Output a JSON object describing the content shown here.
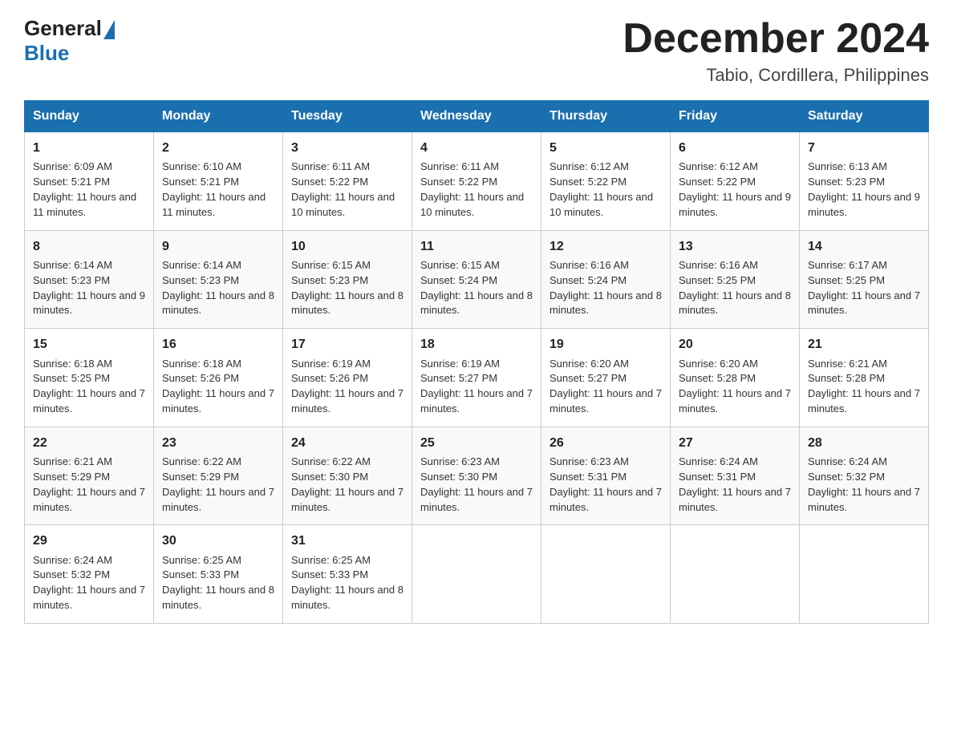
{
  "header": {
    "logo_general": "General",
    "logo_blue": "Blue",
    "month_title": "December 2024",
    "subtitle": "Tabio, Cordillera, Philippines"
  },
  "weekdays": [
    "Sunday",
    "Monday",
    "Tuesday",
    "Wednesday",
    "Thursday",
    "Friday",
    "Saturday"
  ],
  "weeks": [
    [
      {
        "day": "1",
        "sunrise": "Sunrise: 6:09 AM",
        "sunset": "Sunset: 5:21 PM",
        "daylight": "Daylight: 11 hours and 11 minutes."
      },
      {
        "day": "2",
        "sunrise": "Sunrise: 6:10 AM",
        "sunset": "Sunset: 5:21 PM",
        "daylight": "Daylight: 11 hours and 11 minutes."
      },
      {
        "day": "3",
        "sunrise": "Sunrise: 6:11 AM",
        "sunset": "Sunset: 5:22 PM",
        "daylight": "Daylight: 11 hours and 10 minutes."
      },
      {
        "day": "4",
        "sunrise": "Sunrise: 6:11 AM",
        "sunset": "Sunset: 5:22 PM",
        "daylight": "Daylight: 11 hours and 10 minutes."
      },
      {
        "day": "5",
        "sunrise": "Sunrise: 6:12 AM",
        "sunset": "Sunset: 5:22 PM",
        "daylight": "Daylight: 11 hours and 10 minutes."
      },
      {
        "day": "6",
        "sunrise": "Sunrise: 6:12 AM",
        "sunset": "Sunset: 5:22 PM",
        "daylight": "Daylight: 11 hours and 9 minutes."
      },
      {
        "day": "7",
        "sunrise": "Sunrise: 6:13 AM",
        "sunset": "Sunset: 5:23 PM",
        "daylight": "Daylight: 11 hours and 9 minutes."
      }
    ],
    [
      {
        "day": "8",
        "sunrise": "Sunrise: 6:14 AM",
        "sunset": "Sunset: 5:23 PM",
        "daylight": "Daylight: 11 hours and 9 minutes."
      },
      {
        "day": "9",
        "sunrise": "Sunrise: 6:14 AM",
        "sunset": "Sunset: 5:23 PM",
        "daylight": "Daylight: 11 hours and 8 minutes."
      },
      {
        "day": "10",
        "sunrise": "Sunrise: 6:15 AM",
        "sunset": "Sunset: 5:23 PM",
        "daylight": "Daylight: 11 hours and 8 minutes."
      },
      {
        "day": "11",
        "sunrise": "Sunrise: 6:15 AM",
        "sunset": "Sunset: 5:24 PM",
        "daylight": "Daylight: 11 hours and 8 minutes."
      },
      {
        "day": "12",
        "sunrise": "Sunrise: 6:16 AM",
        "sunset": "Sunset: 5:24 PM",
        "daylight": "Daylight: 11 hours and 8 minutes."
      },
      {
        "day": "13",
        "sunrise": "Sunrise: 6:16 AM",
        "sunset": "Sunset: 5:25 PM",
        "daylight": "Daylight: 11 hours and 8 minutes."
      },
      {
        "day": "14",
        "sunrise": "Sunrise: 6:17 AM",
        "sunset": "Sunset: 5:25 PM",
        "daylight": "Daylight: 11 hours and 7 minutes."
      }
    ],
    [
      {
        "day": "15",
        "sunrise": "Sunrise: 6:18 AM",
        "sunset": "Sunset: 5:25 PM",
        "daylight": "Daylight: 11 hours and 7 minutes."
      },
      {
        "day": "16",
        "sunrise": "Sunrise: 6:18 AM",
        "sunset": "Sunset: 5:26 PM",
        "daylight": "Daylight: 11 hours and 7 minutes."
      },
      {
        "day": "17",
        "sunrise": "Sunrise: 6:19 AM",
        "sunset": "Sunset: 5:26 PM",
        "daylight": "Daylight: 11 hours and 7 minutes."
      },
      {
        "day": "18",
        "sunrise": "Sunrise: 6:19 AM",
        "sunset": "Sunset: 5:27 PM",
        "daylight": "Daylight: 11 hours and 7 minutes."
      },
      {
        "day": "19",
        "sunrise": "Sunrise: 6:20 AM",
        "sunset": "Sunset: 5:27 PM",
        "daylight": "Daylight: 11 hours and 7 minutes."
      },
      {
        "day": "20",
        "sunrise": "Sunrise: 6:20 AM",
        "sunset": "Sunset: 5:28 PM",
        "daylight": "Daylight: 11 hours and 7 minutes."
      },
      {
        "day": "21",
        "sunrise": "Sunrise: 6:21 AM",
        "sunset": "Sunset: 5:28 PM",
        "daylight": "Daylight: 11 hours and 7 minutes."
      }
    ],
    [
      {
        "day": "22",
        "sunrise": "Sunrise: 6:21 AM",
        "sunset": "Sunset: 5:29 PM",
        "daylight": "Daylight: 11 hours and 7 minutes."
      },
      {
        "day": "23",
        "sunrise": "Sunrise: 6:22 AM",
        "sunset": "Sunset: 5:29 PM",
        "daylight": "Daylight: 11 hours and 7 minutes."
      },
      {
        "day": "24",
        "sunrise": "Sunrise: 6:22 AM",
        "sunset": "Sunset: 5:30 PM",
        "daylight": "Daylight: 11 hours and 7 minutes."
      },
      {
        "day": "25",
        "sunrise": "Sunrise: 6:23 AM",
        "sunset": "Sunset: 5:30 PM",
        "daylight": "Daylight: 11 hours and 7 minutes."
      },
      {
        "day": "26",
        "sunrise": "Sunrise: 6:23 AM",
        "sunset": "Sunset: 5:31 PM",
        "daylight": "Daylight: 11 hours and 7 minutes."
      },
      {
        "day": "27",
        "sunrise": "Sunrise: 6:24 AM",
        "sunset": "Sunset: 5:31 PM",
        "daylight": "Daylight: 11 hours and 7 minutes."
      },
      {
        "day": "28",
        "sunrise": "Sunrise: 6:24 AM",
        "sunset": "Sunset: 5:32 PM",
        "daylight": "Daylight: 11 hours and 7 minutes."
      }
    ],
    [
      {
        "day": "29",
        "sunrise": "Sunrise: 6:24 AM",
        "sunset": "Sunset: 5:32 PM",
        "daylight": "Daylight: 11 hours and 7 minutes."
      },
      {
        "day": "30",
        "sunrise": "Sunrise: 6:25 AM",
        "sunset": "Sunset: 5:33 PM",
        "daylight": "Daylight: 11 hours and 8 minutes."
      },
      {
        "day": "31",
        "sunrise": "Sunrise: 6:25 AM",
        "sunset": "Sunset: 5:33 PM",
        "daylight": "Daylight: 11 hours and 8 minutes."
      },
      null,
      null,
      null,
      null
    ]
  ]
}
